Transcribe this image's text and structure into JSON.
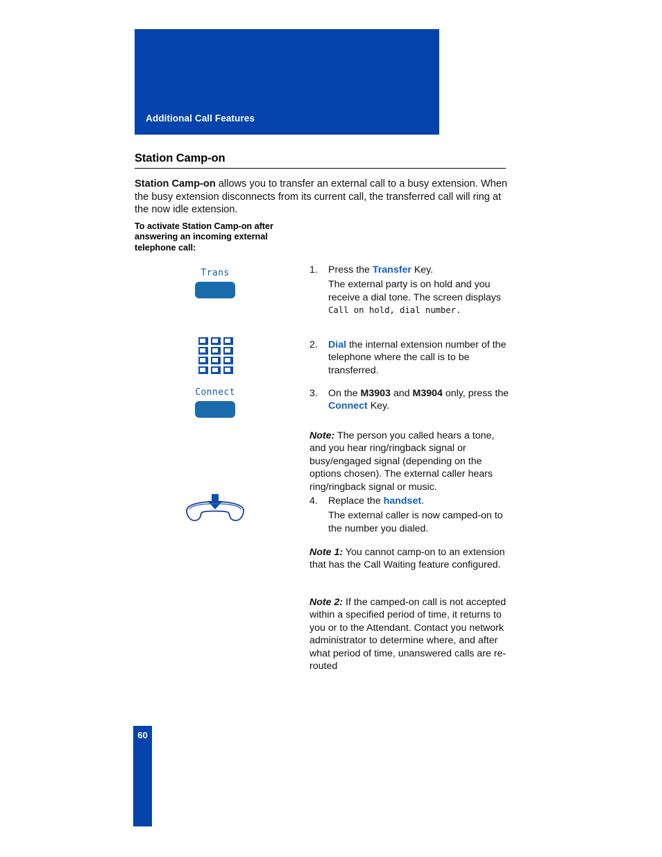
{
  "header": {
    "band_title": "Additional Call Features",
    "band_color": "#0543ad"
  },
  "section": {
    "heading": "Station Camp-on"
  },
  "intro": {
    "bold_term": "Station Camp-on",
    "text": " allows you to transfer an external call to a busy extension. When the busy extension disconnects from its current call, the transferred call will ring at the now idle extension."
  },
  "lead_in": "To activate Station Camp-on after answering an incoming external telephone call:",
  "icons": {
    "transfer_key_label": "Trans",
    "connect_key_label": "Connect",
    "keypad_name": "dialpad-icon",
    "handset_name": "replace-handset-icon",
    "key_button_color": "#1a6bac",
    "keypad_color": "#0f4fae",
    "label_color": "#1558b0"
  },
  "steps": [
    {
      "num": "1.",
      "lead": "Press the ",
      "term": "Transfer",
      "tail": " Key.",
      "sub_a": "The external party is on hold and you receive a dial tone. The screen displays ",
      "sub_mono": "Call on hold, dial number.",
      "sub_b": ""
    },
    {
      "num": "2.",
      "lead": "",
      "term": "Dial",
      "tail": " the internal extension number of the telephone where the call is to be transferred.",
      "sub_a": "",
      "sub_mono": "",
      "sub_b": ""
    },
    {
      "num": "3.",
      "lead": "On the ",
      "term": "",
      "tail": "",
      "model_a": "M3903",
      "mid": " and ",
      "model_b": "M3904",
      "tail2": " only, press the ",
      "term2": "Connect",
      "tail3": " Key."
    },
    {
      "num": "4.",
      "lead": "Replace the ",
      "term": "handset",
      "tail": ".",
      "sub_a": "The external caller is now camped-on to the number you dialed.",
      "sub_mono": "",
      "sub_b": ""
    }
  ],
  "notes": [
    {
      "lead": "Note:",
      "text": " The person you called hears a tone, and you hear ring/ringback signal or busy/engaged signal (depending on the options chosen). The external caller hears ring/ringback signal or music."
    },
    {
      "lead": "Note 1:",
      "text": "  You cannot camp-on to an extension that has the Call Waiting feature configured."
    },
    {
      "lead": "Note 2:",
      "text": "   If the camped-on call is not accepted within a specified period of time, it returns to you or to the Attendant. Contact you network administrator to determine where, and after what period of time, unanswered calls are re-routed"
    }
  ],
  "footer": {
    "page_number": "60"
  }
}
